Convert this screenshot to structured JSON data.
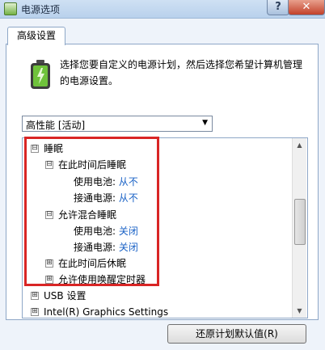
{
  "window": {
    "title": "电源选项",
    "help_label": "?",
    "close_label": "✕"
  },
  "tab": {
    "label": "高级设置"
  },
  "description": "选择您要自定义的电源计划，然后选择您希望计算机管理的电源设置。",
  "dropdown": {
    "selected": "高性能 [活动]"
  },
  "tree": {
    "items": [
      {
        "label": "睡眠",
        "level": 0,
        "expander": "⊟"
      },
      {
        "label": "在此时间后睡眠",
        "level": 1,
        "expander": "⊟"
      },
      {
        "label": "使用电池:",
        "value": "从不",
        "level": 2
      },
      {
        "label": "接通电源:",
        "value": "从不",
        "level": 2
      },
      {
        "label": "允许混合睡眠",
        "level": 1,
        "expander": "⊟"
      },
      {
        "label": "使用电池:",
        "value": "关闭",
        "level": 2
      },
      {
        "label": "接通电源:",
        "value": "关闭",
        "level": 2
      },
      {
        "label": "在此时间后休眠",
        "level": 1,
        "expander": "⊞"
      },
      {
        "label": "允许使用唤醒定时器",
        "level": 1,
        "expander": "⊞"
      },
      {
        "label": "USB 设置",
        "level": 0,
        "expander": "⊞"
      },
      {
        "label": "Intel(R) Graphics Settings",
        "level": 0,
        "expander": "⊞"
      }
    ]
  },
  "restore_button": {
    "label": "还原计划默认值(R)"
  },
  "colors": {
    "value_link": "#1a62c6",
    "highlight": "#d92525"
  },
  "icons": {
    "battery": "battery-icon",
    "app": "power-options-icon"
  }
}
